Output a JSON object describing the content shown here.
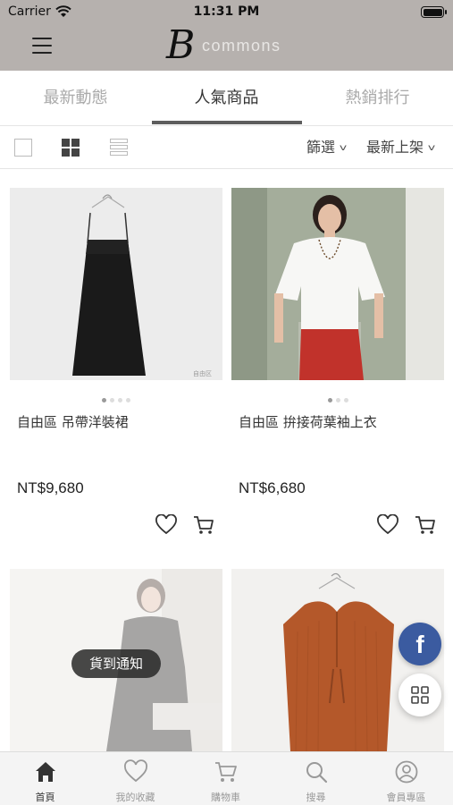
{
  "status_bar": {
    "carrier": "Carrier",
    "time": "11:31 PM"
  },
  "header": {
    "logo_mark": "B",
    "logo_text": "commons"
  },
  "tabs": [
    {
      "label": "最新動態",
      "active": false
    },
    {
      "label": "人氣商品",
      "active": true
    },
    {
      "label": "熱銷排行",
      "active": false
    }
  ],
  "toolbar": {
    "filter_label": "篩選",
    "sort_label": "最新上架"
  },
  "products": [
    {
      "name": "自由區 吊帶洋裝裙",
      "price": "NT$9,680",
      "image_count": 4,
      "current_image": 1
    },
    {
      "name": "自由區 拚接荷葉袖上衣",
      "price": "NT$6,680",
      "image_count": 3,
      "current_image": 1
    },
    {
      "name": "",
      "price": "",
      "badge": "貨到通知"
    },
    {
      "name": "",
      "price": ""
    }
  ],
  "floating": {
    "facebook_glyph": "f"
  },
  "bottom_nav": [
    {
      "label": "首頁",
      "icon": "home-icon",
      "active": true
    },
    {
      "label": "我的收藏",
      "icon": "heart-icon",
      "active": false
    },
    {
      "label": "購物車",
      "icon": "cart-icon",
      "active": false
    },
    {
      "label": "搜尋",
      "icon": "search-icon",
      "active": false
    },
    {
      "label": "會員專區",
      "icon": "user-icon",
      "active": false
    }
  ],
  "colors": {
    "header_bg": "#b6b1ae",
    "facebook_blue": "#3b5ba0",
    "dress_brown": "#b4582a",
    "skirt_red": "#c1322b"
  }
}
